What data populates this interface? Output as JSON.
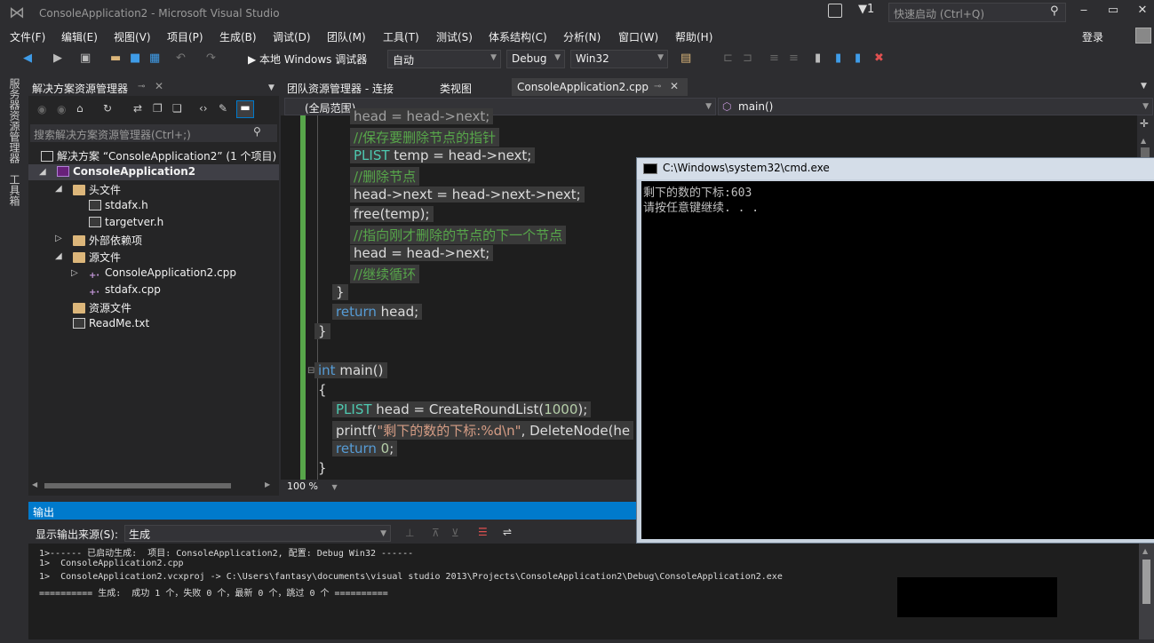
{
  "titlebar": {
    "title": "ConsoleApplication2 - Microsoft Visual Studio",
    "flag_count": "1",
    "quick_launch_placeholder": "快速启动 (Ctrl+Q)",
    "minimize": "‒",
    "maximize": "▭",
    "close": "✕"
  },
  "menu": {
    "items": [
      "文件(F)",
      "编辑(E)",
      "视图(V)",
      "项目(P)",
      "生成(B)",
      "调试(D)",
      "团队(M)",
      "工具(T)",
      "测试(S)",
      "体系结构(C)",
      "分析(N)",
      "窗口(W)",
      "帮助(H)"
    ],
    "login": "登录"
  },
  "toolbar": {
    "run_label": "▶ 本地 Windows 调试器",
    "config_auto": "自动",
    "config": "Debug",
    "platform": "Win32"
  },
  "vertical_tabs": [
    "服务器资源管理器",
    "工具箱"
  ],
  "solution_explorer": {
    "title": "解决方案资源管理器",
    "search_placeholder": "搜索解决方案资源管理器(Ctrl+;)",
    "tree": [
      {
        "label": "解决方案 “ConsoleApplication2” (1 个项目)",
        "icon": "solution-icon"
      },
      {
        "label": "ConsoleApplication2",
        "icon": "project-icon"
      },
      {
        "label": "头文件",
        "icon": "folder-icon"
      },
      {
        "label": "stdafx.h",
        "icon": "file-icon"
      },
      {
        "label": "targetver.h",
        "icon": "file-icon"
      },
      {
        "label": "外部依赖项",
        "icon": "folder-icon"
      },
      {
        "label": "源文件",
        "icon": "folder-icon"
      },
      {
        "label": "ConsoleApplication2.cpp",
        "icon": "cpp-icon"
      },
      {
        "label": "stdafx.cpp",
        "icon": "cpp-icon"
      },
      {
        "label": "资源文件",
        "icon": "folder-icon"
      },
      {
        "label": "ReadMe.txt",
        "icon": "file-icon"
      }
    ]
  },
  "editor": {
    "tabs": [
      "团队资源管理器 - 连接",
      "类视图",
      "ConsoleApplication2.cpp"
    ],
    "scope": "(全局范围)",
    "function": "main()",
    "zoom": "100 %",
    "code": {
      "l0": "head = head->next;",
      "l1": "//保存要删除节点的指针",
      "l2a": "PLIST",
      "l2b": " temp = head->next;",
      "l3": "//删除节点",
      "l4": "head->next = head->next->next;",
      "l5": "free(temp);",
      "l6": "//指向刚才删除的节点的下一个节点",
      "l7": "head = head->next;",
      "l8": "//继续循环",
      "l9": "}",
      "l10a": "return",
      "l10b": " head;",
      "l11": "}",
      "l12a": "int",
      "l12b": " main()",
      "l13": "{",
      "l14a": "PLIST",
      "l14b": " head = CreateRoundList(",
      "l14c": "1000",
      "l14d": ");",
      "l15a": "printf(",
      "l15b": "\"剩下的数的下标:%d\\n\"",
      "l15c": ", DeleteNode(he",
      "l16a": "return",
      "l16b": " ",
      "l16c": "0",
      "l16d": ";",
      "l17": "}"
    }
  },
  "output": {
    "title": "输出",
    "source_label": "显示输出来源(S):",
    "source_value": "生成",
    "lines": [
      "1>------ 已启动生成:  项目: ConsoleApplication2, 配置: Debug Win32 ------",
      "1>  ConsoleApplication2.cpp",
      "1>  ConsoleApplication2.vcxproj -> C:\\Users\\fantasy\\documents\\visual studio 2013\\Projects\\ConsoleApplication2\\Debug\\ConsoleApplication2.exe",
      "========== 生成:  成功 1 个，失败 0 个，最新 0 个，跳过 0 个 =========="
    ]
  },
  "cmd": {
    "title": "C:\\Windows\\system32\\cmd.exe",
    "line1": "剩下的数的下标:603",
    "line2": "请按任意键继续. . ."
  }
}
